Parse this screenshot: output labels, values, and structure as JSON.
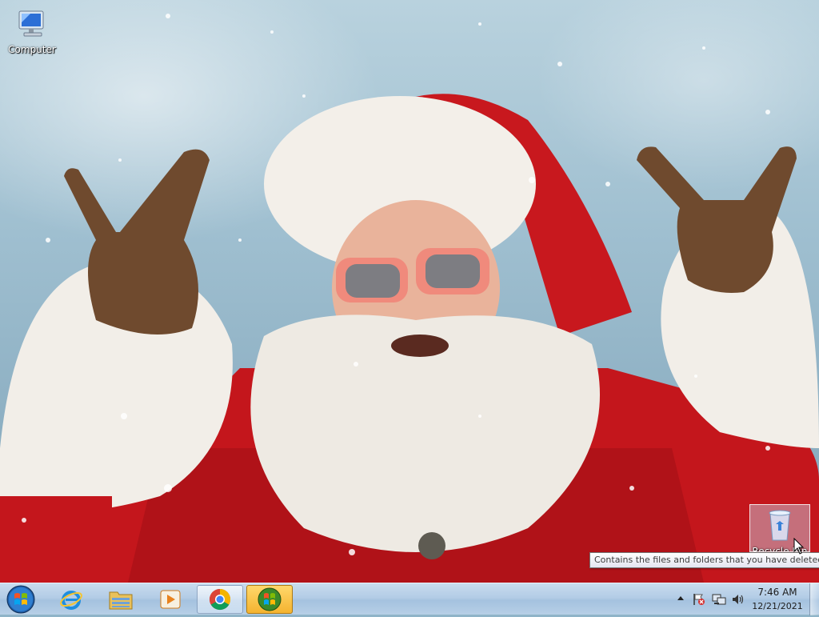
{
  "desktop": {
    "icons": [
      {
        "label": "Computer"
      },
      {
        "label": "Recycle Bin"
      }
    ],
    "tooltip": "Contains the files and folders that you have deleted."
  },
  "taskbar": {
    "start": {
      "icon": "windows-orb-icon"
    },
    "pinned": [
      {
        "icon": "internet-explorer-icon"
      },
      {
        "icon": "windows-explorer-icon"
      },
      {
        "icon": "media-player-icon"
      },
      {
        "icon": "chrome-icon"
      },
      {
        "icon": "windows-logo-icon"
      }
    ],
    "tray": {
      "icons": [
        "show-hidden-icons-arrow-icon",
        "action-center-flag-icon",
        "network-icon",
        "volume-icon"
      ],
      "time": "7:46 AM",
      "date": "12/21/2021"
    }
  },
  "colors": {
    "taskbar": "#b3cce6",
    "active_button": "#f4b330",
    "santa_red": "#c4161c"
  }
}
